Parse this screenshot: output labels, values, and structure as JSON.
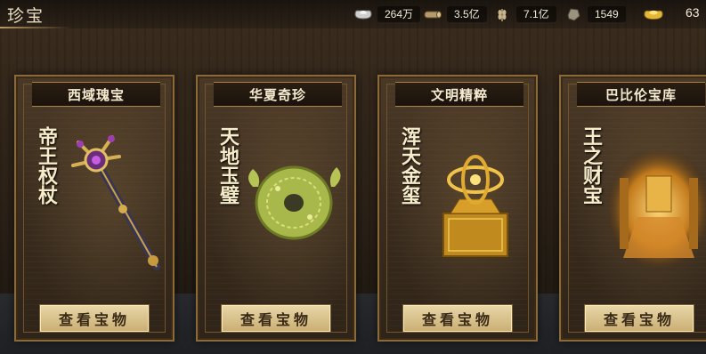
{
  "header": {
    "title": "珍宝",
    "resources": [
      {
        "icon": "silver-ingot-icon",
        "value": "264万"
      },
      {
        "icon": "timber-icon",
        "value": "3.5亿"
      },
      {
        "icon": "grain-icon",
        "value": "7.1亿"
      },
      {
        "icon": "stone-icon",
        "value": "1549"
      }
    ],
    "gold": {
      "icon": "gold-ingot-icon",
      "value": "63"
    }
  },
  "cards": [
    {
      "region": "西域瑰宝",
      "treasure": "帝王权杖",
      "button": "查看宝物",
      "art": "scepter"
    },
    {
      "region": "华夏奇珍",
      "treasure": "天地玉璧",
      "button": "查看宝物",
      "art": "jade-disc"
    },
    {
      "region": "文明精粹",
      "treasure": "浑天金玺",
      "button": "查看宝物",
      "art": "golden-seal"
    },
    {
      "region": "巴比伦宝库",
      "treasure": "王之财宝",
      "button": "查看宝物",
      "art": "treasure-vault"
    }
  ],
  "colors": {
    "accent_gold": "#c9ae72",
    "card_border": "#8a6a3a",
    "text_light": "#f5ead0"
  }
}
